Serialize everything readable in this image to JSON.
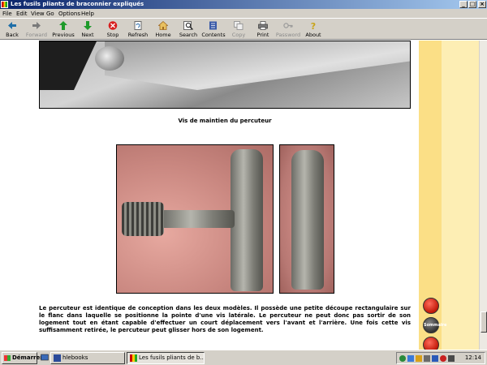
{
  "window": {
    "title": "Les fusils pliants de braconnier expliqués",
    "controls": [
      "_",
      "□",
      "×"
    ]
  },
  "menu": [
    "File",
    "Edit",
    "View",
    "Go",
    "Options",
    "Help"
  ],
  "toolbar": [
    {
      "label": "Back",
      "icon": "arrow-left-icon",
      "color": "#1e6ea8",
      "enabled": true
    },
    {
      "label": "Forward",
      "icon": "arrow-right-icon",
      "color": "#7a7a7a",
      "enabled": false
    },
    {
      "label": "Previous",
      "icon": "arrow-up-icon",
      "color": "#1e9a2a",
      "enabled": true
    },
    {
      "label": "Next",
      "icon": "arrow-down-icon",
      "color": "#1e9a2a",
      "enabled": true
    },
    {
      "label": "Stop",
      "icon": "stop-icon",
      "color": "#d81e1e",
      "enabled": true
    },
    {
      "label": "Refresh",
      "icon": "refresh-icon",
      "color": "#6a6a6a",
      "enabled": true
    },
    {
      "label": "Home",
      "icon": "home-icon",
      "color": "#a06a20",
      "enabled": true
    },
    {
      "label": "Search",
      "icon": "search-icon",
      "color": "#4a4a4a",
      "enabled": true
    },
    {
      "label": "Contents",
      "icon": "contents-icon",
      "color": "#3a5aa8",
      "enabled": true
    },
    {
      "label": "Copy",
      "icon": "copy-icon",
      "color": "#9a9a9a",
      "enabled": false
    },
    {
      "label": "Print",
      "icon": "printer-icon",
      "color": "#3a3a3a",
      "enabled": true
    },
    {
      "label": "Password",
      "icon": "key-icon",
      "color": "#9a9a9a",
      "enabled": false
    },
    {
      "label": "About",
      "icon": "question-icon",
      "color": "#c8a418",
      "enabled": true
    }
  ],
  "content": {
    "caption": "Vis de maintien du percuteur",
    "paragraph": "Le percuteur est identique de conception dans les deux modèles. Il possède une petite découpe rectangulaire sur le flanc dans laquelle se positionne la pointe d'une vis latérale. Le percuteur ne peut donc pas sortir de son logement tout en étant capable d'effectuer un court déplacement vers l'avant et l'arrière. Une fois cette vis suffisamment retirée, le percuteur peut glisser hors de son logement.",
    "nav_middle_label": "Sommaire"
  },
  "taskbar": {
    "start_label": "Démarrer",
    "tasks": [
      {
        "label": "hlebooks",
        "active": false
      },
      {
        "label": "Les fusils pliants de b...",
        "active": true
      }
    ],
    "clock": "12:14"
  },
  "colors": {
    "title_bar_start": "#0a246a",
    "band_dark": "#fbdf86",
    "band_light": "#fdeeb4",
    "chrome": "#d4d0c8"
  }
}
